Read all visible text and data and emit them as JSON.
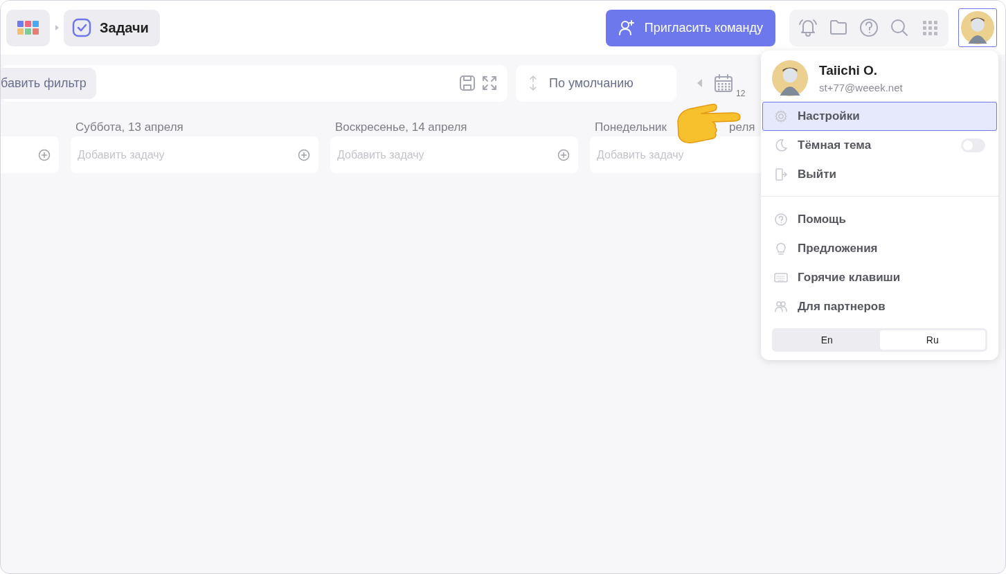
{
  "header": {
    "breadcrumb": "Задачи",
    "invite_button": "Пригласить команду"
  },
  "toolbar": {
    "filter_chip": "бавить фильтр",
    "sort": "По умолчанию",
    "date_fragment": "12"
  },
  "columns": [
    {
      "kind": "cut"
    },
    {
      "kind": "day",
      "title_parts": [
        "Суббота, 13 апреля"
      ],
      "placeholder": "Добавить задачу"
    },
    {
      "kind": "day",
      "title_parts": [
        "Воскресенье, 14 апреля"
      ],
      "placeholder": "Добавить задачу"
    },
    {
      "kind": "day_covered",
      "title_parts": [
        "Понедельник",
        "реля"
      ],
      "placeholder": "Добавить задачу"
    }
  ],
  "user_menu": {
    "name": "Taiichi O.",
    "email": "st+77@weeek.net",
    "groups": [
      [
        {
          "kind": "link",
          "label": "Настройки",
          "selected": true
        },
        {
          "kind": "toggle",
          "label": "Тёмная тема",
          "selected": false,
          "on": false
        },
        {
          "kind": "link",
          "label": "Выйти",
          "selected": false
        }
      ],
      [
        {
          "kind": "link",
          "label": "Помощь",
          "selected": false
        },
        {
          "kind": "link",
          "label": "Предложения",
          "selected": false
        },
        {
          "kind": "link",
          "label": "Горячие клавиши",
          "selected": false
        },
        {
          "kind": "link",
          "label": "Для партнеров",
          "selected": false
        }
      ]
    ],
    "languages": [
      {
        "label": "En",
        "selected": false
      },
      {
        "label": "Ru",
        "selected": true
      }
    ]
  }
}
